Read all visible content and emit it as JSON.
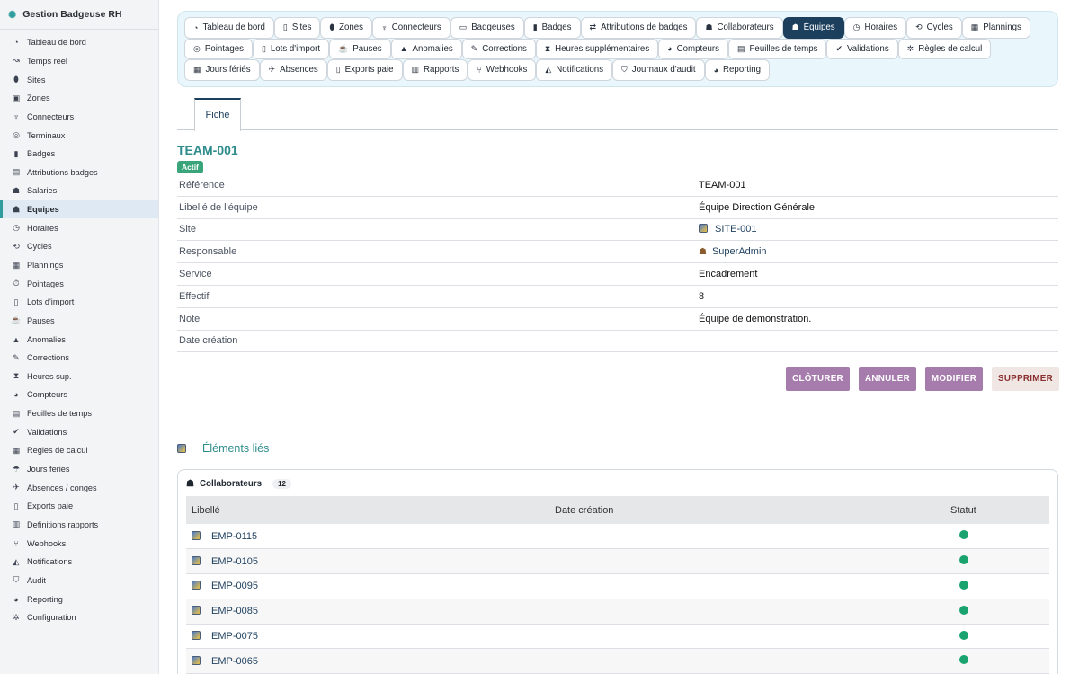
{
  "app": {
    "brand": "Gestion Badgeuse RH",
    "brand_icon": "network-icon"
  },
  "sidebar": {
    "items": [
      {
        "label": "Tableau de bord",
        "icon": "dashboard-icon",
        "glyph": "◔"
      },
      {
        "label": "Temps reel",
        "icon": "satellite-icon",
        "glyph": "↝"
      },
      {
        "label": "Sites",
        "icon": "map-pin-icon",
        "glyph": "⬮"
      },
      {
        "label": "Zones",
        "icon": "vector-square-icon",
        "glyph": "▣"
      },
      {
        "label": "Connecteurs",
        "icon": "plug-icon",
        "glyph": "♆"
      },
      {
        "label": "Terminaux",
        "icon": "fingerprint-icon",
        "glyph": "◎"
      },
      {
        "label": "Badges",
        "icon": "id-badge-icon",
        "glyph": "▮"
      },
      {
        "label": "Attributions badges",
        "icon": "id-card-icon",
        "glyph": "▤"
      },
      {
        "label": "Salaries",
        "icon": "users-icon",
        "glyph": "☗"
      },
      {
        "label": "Equipes",
        "icon": "users-group-icon",
        "glyph": "☗"
      },
      {
        "label": "Horaires",
        "icon": "clock-icon",
        "glyph": "◷"
      },
      {
        "label": "Cycles",
        "icon": "sync-icon",
        "glyph": "⟲"
      },
      {
        "label": "Plannings",
        "icon": "calendar-icon",
        "glyph": "▦"
      },
      {
        "label": "Pointages",
        "icon": "stopwatch-icon",
        "glyph": "⏱"
      },
      {
        "label": "Lots d'import",
        "icon": "file-import-icon",
        "glyph": "▯"
      },
      {
        "label": "Pauses",
        "icon": "coffee-icon",
        "glyph": "☕"
      },
      {
        "label": "Anomalies",
        "icon": "warning-icon",
        "glyph": "▲"
      },
      {
        "label": "Corrections",
        "icon": "edit-icon",
        "glyph": "✎"
      },
      {
        "label": "Heures sup.",
        "icon": "hourglass-icon",
        "glyph": "⧗"
      },
      {
        "label": "Compteurs",
        "icon": "gauge-icon",
        "glyph": "◕"
      },
      {
        "label": "Feuilles de temps",
        "icon": "timesheet-icon",
        "glyph": "▤"
      },
      {
        "label": "Validations",
        "icon": "check-double-icon",
        "glyph": "✔"
      },
      {
        "label": "Regles de calcul",
        "icon": "calculator-icon",
        "glyph": "▦"
      },
      {
        "label": "Jours feries",
        "icon": "umbrella-beach-icon",
        "glyph": "☂"
      },
      {
        "label": "Absences / conges",
        "icon": "plane-icon",
        "glyph": "✈"
      },
      {
        "label": "Exports paie",
        "icon": "file-export-icon",
        "glyph": "▯"
      },
      {
        "label": "Definitions rapports",
        "icon": "chart-bar-icon",
        "glyph": "▥"
      },
      {
        "label": "Webhooks",
        "icon": "code-branch-icon",
        "glyph": "⑂"
      },
      {
        "label": "Notifications",
        "icon": "bell-icon",
        "glyph": "◭"
      },
      {
        "label": "Audit",
        "icon": "shield-icon",
        "glyph": "⛉"
      },
      {
        "label": "Reporting",
        "icon": "chart-pie-icon",
        "glyph": "◕"
      },
      {
        "label": "Configuration",
        "icon": "gear-icon",
        "glyph": "✲"
      }
    ],
    "active_index": 9
  },
  "tabs": [
    {
      "label": "Tableau de bord",
      "icon": "dashboard-icon",
      "glyph": "◔"
    },
    {
      "label": "Sites",
      "icon": "building-icon",
      "glyph": "▯"
    },
    {
      "label": "Zones",
      "icon": "map-pin-icon",
      "glyph": "⬮"
    },
    {
      "label": "Connecteurs",
      "icon": "plug-icon",
      "glyph": "♆"
    },
    {
      "label": "Badgeuses",
      "icon": "tablet-icon",
      "glyph": "▭"
    },
    {
      "label": "Badges",
      "icon": "id-badge-icon",
      "glyph": "▮"
    },
    {
      "label": "Attributions de badges",
      "icon": "exchange-icon",
      "glyph": "⇄"
    },
    {
      "label": "Collaborateurs",
      "icon": "user-icon",
      "glyph": "☗"
    },
    {
      "label": "Équipes",
      "icon": "users-group-icon",
      "glyph": "☗"
    },
    {
      "label": "Horaires",
      "icon": "clock-icon",
      "glyph": "◷"
    },
    {
      "label": "Cycles",
      "icon": "sync-icon",
      "glyph": "⟲"
    },
    {
      "label": "Plannings",
      "icon": "calendar-icon",
      "glyph": "▦"
    },
    {
      "label": "Pointages",
      "icon": "fingerprint-icon",
      "glyph": "◎"
    },
    {
      "label": "Lots d'import",
      "icon": "file-import-icon",
      "glyph": "▯"
    },
    {
      "label": "Pauses",
      "icon": "coffee-icon",
      "glyph": "☕"
    },
    {
      "label": "Anomalies",
      "icon": "warning-icon",
      "glyph": "▲"
    },
    {
      "label": "Corrections",
      "icon": "edit-icon",
      "glyph": "✎"
    },
    {
      "label": "Heures supplémentaires",
      "icon": "hourglass-icon",
      "glyph": "⧗"
    },
    {
      "label": "Compteurs",
      "icon": "gauge-icon",
      "glyph": "◕"
    },
    {
      "label": "Feuilles de temps",
      "icon": "table-icon",
      "glyph": "▤"
    },
    {
      "label": "Validations",
      "icon": "check-double-icon",
      "glyph": "✔"
    },
    {
      "label": "Règles de calcul",
      "icon": "cogs-icon",
      "glyph": "✲"
    },
    {
      "label": "Jours fériés",
      "icon": "calendar-day-icon",
      "glyph": "▦"
    },
    {
      "label": "Absences",
      "icon": "plane-icon",
      "glyph": "✈"
    },
    {
      "label": "Exports paie",
      "icon": "file-export-icon",
      "glyph": "▯"
    },
    {
      "label": "Rapports",
      "icon": "chart-bar-icon",
      "glyph": "▥"
    },
    {
      "label": "Webhooks",
      "icon": "sitemap-icon",
      "glyph": "⑂"
    },
    {
      "label": "Notifications",
      "icon": "bell-icon",
      "glyph": "◭"
    },
    {
      "label": "Journaux d'audit",
      "icon": "shield-icon",
      "glyph": "⛉"
    },
    {
      "label": "Reporting",
      "icon": "chart-pie-icon",
      "glyph": "◕"
    }
  ],
  "active_tab_index": 8,
  "subtab": {
    "label": "Fiche"
  },
  "record": {
    "title": "TEAM-001",
    "status": "Actif",
    "fields": [
      {
        "label": "Référence",
        "value": "TEAM-001",
        "kind": "text"
      },
      {
        "label": "Libellé de l'équipe",
        "value": "Équipe Direction Générale",
        "kind": "text"
      },
      {
        "label": "Site",
        "value": "SITE-001",
        "kind": "link-image"
      },
      {
        "label": "Responsable",
        "value": "SuperAdmin",
        "kind": "link-user"
      },
      {
        "label": "Service",
        "value": "Encadrement",
        "kind": "text"
      },
      {
        "label": "Effectif",
        "value": "8",
        "kind": "text"
      },
      {
        "label": "Note",
        "value": "Équipe de démonstration.",
        "kind": "text"
      },
      {
        "label": "Date création",
        "value": "",
        "kind": "text"
      }
    ]
  },
  "actions": {
    "close": "CLÔTURER",
    "cancel": "ANNULER",
    "edit": "MODIFIER",
    "delete": "SUPPRIMER"
  },
  "linked": {
    "title": "Éléments liés",
    "panel_title": "Collaborateurs",
    "count": "12",
    "columns": [
      "Libellé",
      "Date création",
      "Statut"
    ],
    "rows": [
      {
        "label": "EMP-0115",
        "date": "",
        "status_color": "#1aa36e"
      },
      {
        "label": "EMP-0105",
        "date": "",
        "status_color": "#1aa36e"
      },
      {
        "label": "EMP-0095",
        "date": "",
        "status_color": "#1aa36e"
      },
      {
        "label": "EMP-0085",
        "date": "",
        "status_color": "#1aa36e"
      },
      {
        "label": "EMP-0075",
        "date": "",
        "status_color": "#1aa36e"
      },
      {
        "label": "EMP-0065",
        "date": "",
        "status_color": "#1aa36e"
      }
    ]
  },
  "colors": {
    "accent": "#2e9c9c",
    "active_tab": "#1d3f5e",
    "button": "#a67cad",
    "status_active": "#3aa57a"
  }
}
